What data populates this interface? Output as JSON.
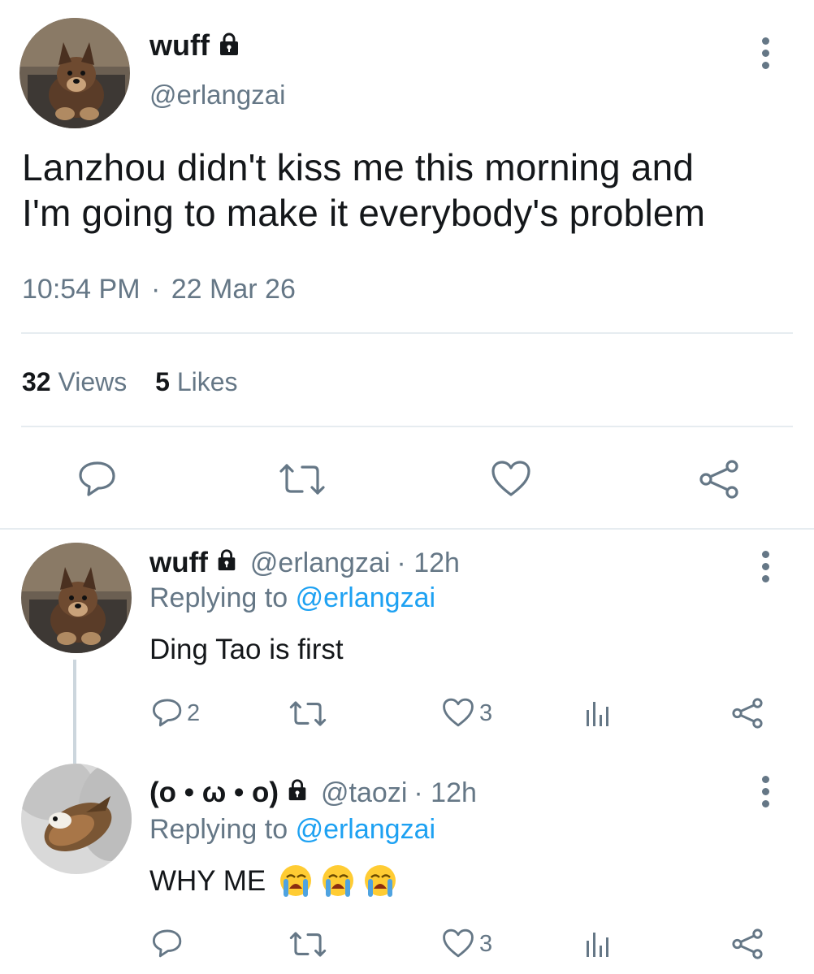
{
  "main_tweet": {
    "display_name": "wuff",
    "handle": "@erlangzai",
    "text_line1": "Lanzhou didn't kiss me this morning and",
    "text_line2": "I'm going to make it everybody's problem",
    "time": "10:54 PM",
    "separator": "·",
    "date": "22 Mar 26",
    "views_count": "32",
    "views_label": "Views",
    "likes_count": "5",
    "likes_label": "Likes"
  },
  "replies": [
    {
      "display_name": "wuff",
      "handle": "@erlangzai",
      "time": "· 12h",
      "replying_prefix": "Replying to",
      "replying_handle": "@erlangzai",
      "text": "Ding Tao is first",
      "reply_count": "2",
      "like_count": "3"
    },
    {
      "display_name": "(o • ω • o)",
      "handle": "@taozi",
      "time": "· 12h",
      "replying_prefix": "Replying to",
      "replying_handle": "@erlangzai",
      "text": "WHY ME",
      "emoji": "😭😭😭",
      "like_count": "3"
    }
  ],
  "icons": [
    "lock-icon",
    "more-icon",
    "reply-icon",
    "retweet-icon",
    "like-icon",
    "share-icon",
    "analytics-icon",
    "crying-emoji"
  ],
  "colors": {
    "text": "#14171a",
    "muted": "#657786",
    "link": "#1da1f2",
    "divider": "#e6ecf0"
  }
}
